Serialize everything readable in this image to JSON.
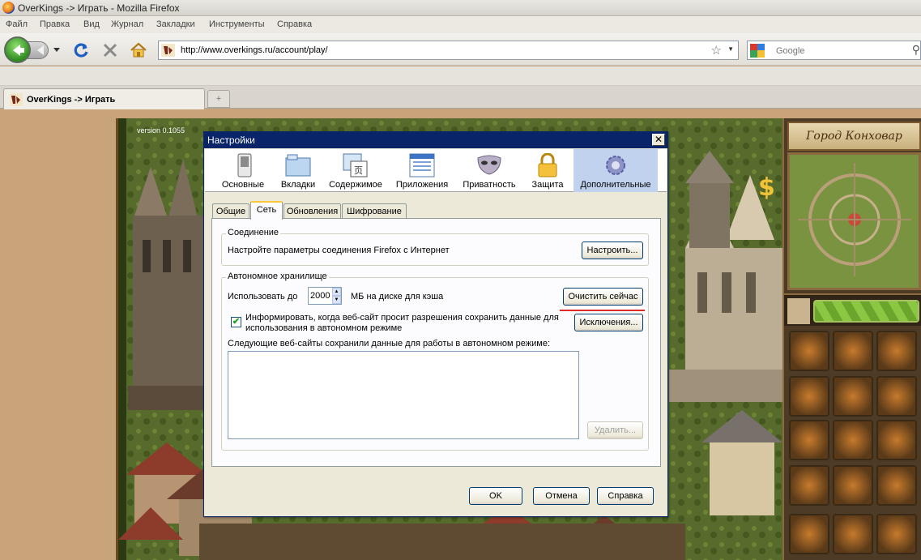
{
  "window": {
    "title": "OverKings -> Играть - Mozilla Firefox"
  },
  "menu": [
    "Файл",
    "Правка",
    "Вид",
    "Журнал",
    "Закладки",
    "Инструменты",
    "Справка"
  ],
  "navigation": {
    "url": "http://www.overkings.ru/account/play/",
    "search_placeholder": "Google"
  },
  "tab": {
    "label": "OverKings -> Играть",
    "new_tab_glyph": "+"
  },
  "game": {
    "version": "version 0.1055",
    "city_title": "Город Конховар"
  },
  "dialog": {
    "title": "Настройки",
    "close_glyph": "✕",
    "panes": [
      {
        "label": "Основные",
        "icon": "switch-icon"
      },
      {
        "label": "Вкладки",
        "icon": "folder-tabs-icon"
      },
      {
        "label": "Содержимое",
        "icon": "content-icon"
      },
      {
        "label": "Приложения",
        "icon": "applications-icon"
      },
      {
        "label": "Приватность",
        "icon": "mask-icon"
      },
      {
        "label": "Защита",
        "icon": "padlock-icon"
      },
      {
        "label": "Дополнительные",
        "icon": "gear-icon"
      }
    ],
    "selected_pane": "Дополнительные",
    "subtabs": [
      "Общие",
      "Сеть",
      "Обновления",
      "Шифрование"
    ],
    "selected_subtab": "Сеть",
    "connection": {
      "caption": "Соединение",
      "description": "Настройте параметры соединения Firefox с Интернет",
      "button": "Настроить..."
    },
    "offline": {
      "caption": "Автономное хранилище",
      "use_up_to": "Использовать до",
      "cache_value": "2000",
      "cache_unit": "МБ на диске для кэша",
      "clear_button": "Очистить сейчас",
      "notify_checked": true,
      "notify_line1": "Информировать, когда веб-сайт просит разрешения сохранить данные для",
      "notify_line2": "использования в автономном режиме",
      "exceptions_button": "Исключения...",
      "sites_label": "Следующие веб-сайты сохранили данные для работы в автономном режиме:",
      "remove_button": "Удалить..."
    },
    "buttons": {
      "ok": "OK",
      "cancel": "Отмена",
      "help": "Справка"
    }
  },
  "colors": {
    "title_bar": "#0a246a",
    "selected_pane": "#c1d2ee",
    "highlight_line": "#e12b2b"
  }
}
